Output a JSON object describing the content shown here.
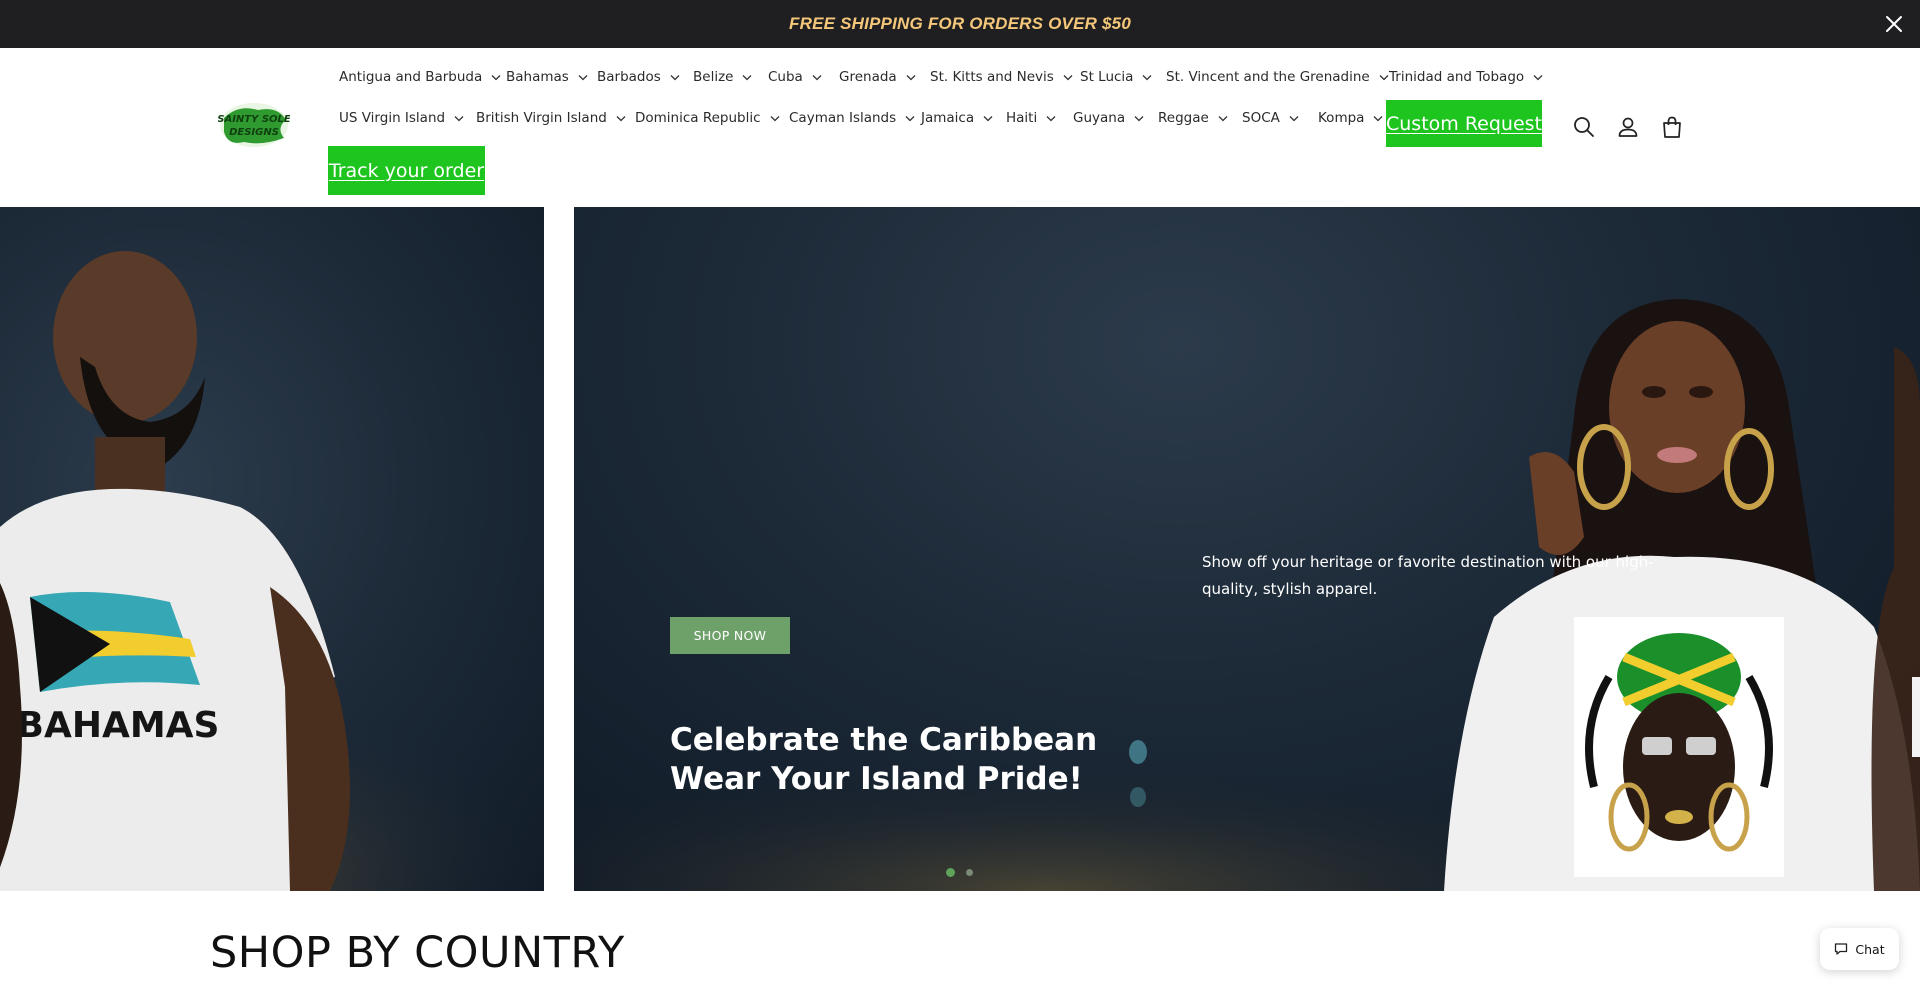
{
  "announcement": {
    "text": "FREE SHIPPING FOR ORDERS OVER $50",
    "close_icon": "close-icon"
  },
  "logo": {
    "icon": "brand-logo-image",
    "text": "SAINTY SOLE DESIGNS"
  },
  "nav": {
    "row1": [
      "Antigua and Barbuda",
      "Bahamas",
      "Barbados",
      "Belize",
      "Cuba",
      "Grenada",
      "St. Kitts and Nevis",
      "St Lucia",
      "St. Vincent and the Grenadine",
      "Trinidad and Tobago"
    ],
    "row2": [
      "US Virgin Island",
      "British Virgin Island",
      "Dominica Republic",
      "Cayman Islands",
      "Jamaica",
      "Haiti",
      "Guyana",
      "Reggae",
      "SOCA",
      "Kompa"
    ],
    "custom_request": "Custom Request",
    "track_order": "Track your order"
  },
  "header_icons": [
    "search-icon",
    "account-icon",
    "cart-icon"
  ],
  "hero": {
    "left_shirt_text": "BAHAMAS",
    "subtext": "Show off your heritage or favorite destination with our high-quality, stylish apparel.",
    "button": "SHOP NOW",
    "title": "Celebrate the Caribbean Wear Your Island Pride!",
    "slides": 2,
    "active_slide": 1
  },
  "section": {
    "title": "SHOP BY COUNTRY"
  },
  "chat": {
    "label": "Chat",
    "icon": "chat-bubble-icon"
  },
  "colors": {
    "announce_bg": "#1f1f21",
    "announce_text": "#f4c77a",
    "accent_green": "#1ec51e",
    "shop_now_green": "#6ea16a"
  }
}
